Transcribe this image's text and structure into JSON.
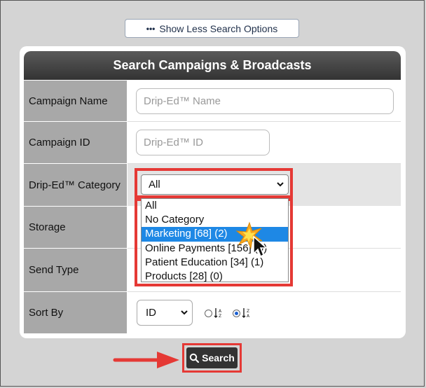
{
  "toggle": {
    "label": "Show Less Search Options",
    "icon": "ellipsis-icon"
  },
  "panel": {
    "title": "Search Campaigns & Broadcasts"
  },
  "fields": {
    "campaign_name": {
      "label": "Campaign Name",
      "placeholder": "Drip-Ed™ Name"
    },
    "campaign_id": {
      "label": "Campaign ID",
      "placeholder": "Drip-Ed™ ID"
    },
    "category": {
      "label": "Drip-Ed™ Category",
      "selected": "All",
      "options": [
        "All",
        "No Category",
        "Marketing [68] (2)",
        "Online Payments [156] (0)",
        "Patient Education [34] (1)",
        "Products [28] (0)"
      ],
      "highlighted_index": 2
    },
    "storage": {
      "label": "Storage"
    },
    "send_type": {
      "label": "Send Type"
    },
    "sort_by": {
      "label": "Sort By",
      "selected": "ID",
      "ascending_checked": false,
      "descending_checked": true
    }
  },
  "search_button": {
    "label": "Search"
  },
  "colors": {
    "highlight_red": "#e53935",
    "option_selected": "#1e88e5",
    "header_dark": "#333333",
    "label_gray": "#a8a8a8"
  }
}
